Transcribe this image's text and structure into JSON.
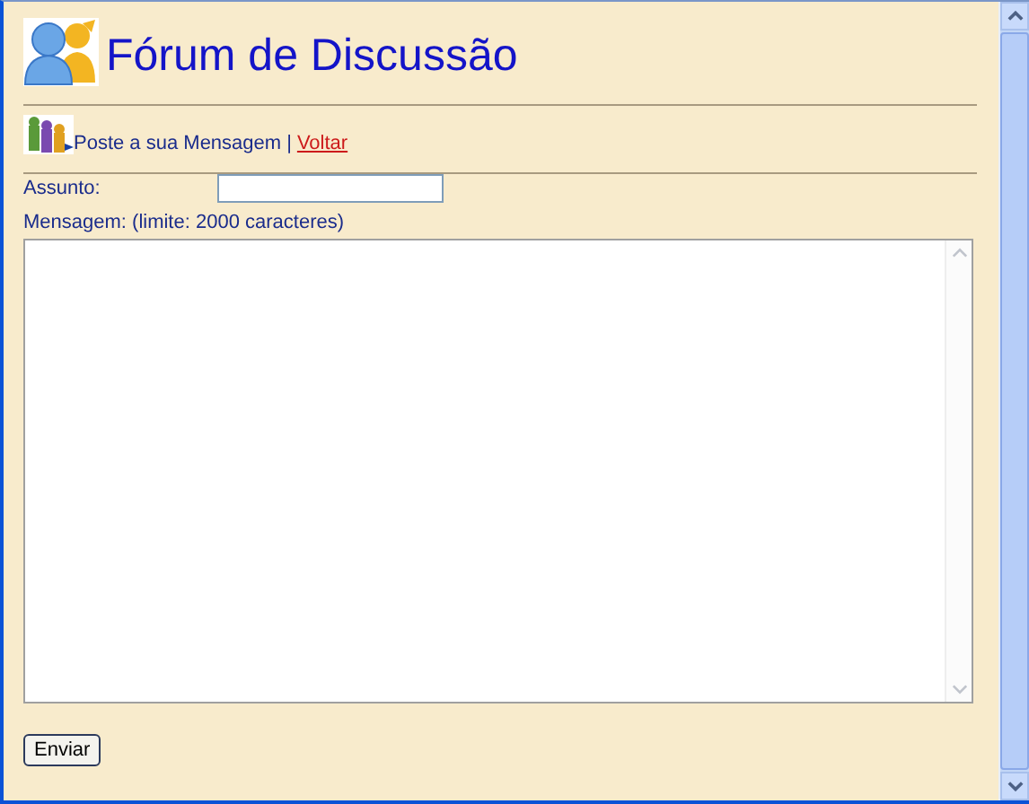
{
  "header": {
    "title": "Fórum de Discussão"
  },
  "nav": {
    "text": "Poste a sua Mensagem",
    "separator": "|",
    "link": "Voltar"
  },
  "form": {
    "subject_label": "Assunto:",
    "message_label": "Mensagem: (limite: 2000 caracteres)",
    "submit": "Enviar"
  }
}
